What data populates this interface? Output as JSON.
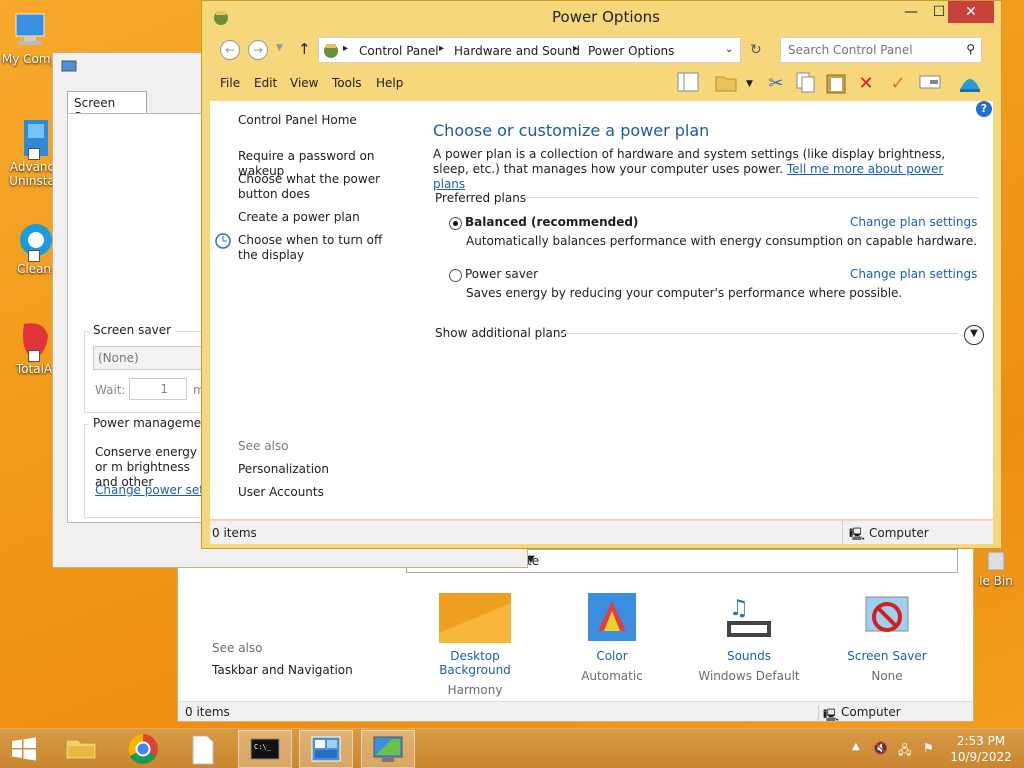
{
  "desktop": {
    "icons": [
      {
        "label": "My Comp"
      },
      {
        "label": "Advanc Uninsta"
      },
      {
        "label": "Clean"
      },
      {
        "label": "TotalA"
      },
      {
        "label": "le Bin"
      }
    ]
  },
  "personalization": {
    "dropdown_text": "te",
    "see_also": "See also",
    "taskbar_link": "Taskbar and Navigation",
    "items": [
      {
        "label": "Desktop Background",
        "sub": "Harmony"
      },
      {
        "label": "Color",
        "sub": "Automatic"
      },
      {
        "label": "Sounds",
        "sub": "Windows Default"
      },
      {
        "label": "Screen Saver",
        "sub": "None"
      }
    ],
    "status_items": "0 items",
    "status_computer": "Computer"
  },
  "screensaver_dialog": {
    "tab": "Screen Saver",
    "group_title": "Screen saver",
    "selected": "(None)",
    "wait_label": "Wait:",
    "wait_value": "1",
    "wait_unit": "m",
    "power_group_title": "Power management",
    "power_text": "Conserve energy or m brightness and other",
    "power_link": "Change power settin"
  },
  "power_window": {
    "title": "Power Options",
    "controls": {
      "minimize": "—",
      "maximize": "☐",
      "close": "✕"
    },
    "breadcrumbs": [
      "Control Panel",
      "Hardware and Sound",
      "Power Options"
    ],
    "search_placeholder": "Search Control Panel",
    "menu": [
      "File",
      "Edit",
      "View",
      "Tools",
      "Help"
    ],
    "sidebar": {
      "home": "Control Panel Home",
      "links": [
        "Require a password on wakeup",
        "Choose what the power button does",
        "Create a power plan",
        "Choose when to turn off the display"
      ],
      "see_also": "See also",
      "see_also_links": [
        "Personalization",
        "User Accounts"
      ]
    },
    "heading": "Choose or customize a power plan",
    "description": "A power plan is a collection of hardware and system settings (like display brightness, sleep, etc.) that manages how your computer uses power.",
    "description_link": "Tell me more about power plans",
    "preferred_title": "Preferred plans",
    "plans": [
      {
        "name": "Balanced (recommended)",
        "desc": "Automatically balances performance with energy consumption on capable hardware.",
        "change": "Change plan settings",
        "selected": true
      },
      {
        "name": "Power saver",
        "desc": "Saves energy by reducing your computer's performance where possible.",
        "change": "Change plan settings",
        "selected": false
      }
    ],
    "additional_plans": "Show additional plans",
    "status_items": "0 items",
    "status_computer": "Computer"
  },
  "taskbar": {
    "time": "2:53 PM",
    "date": "10/9/2022"
  }
}
